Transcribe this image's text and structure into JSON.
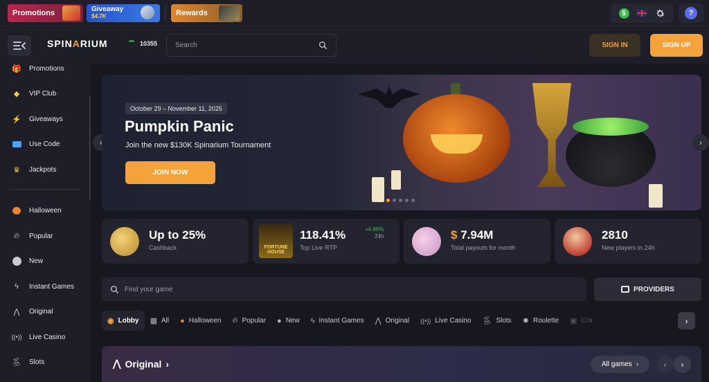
{
  "topbar": {
    "promos": [
      {
        "label": "Promotions"
      },
      {
        "label": "Giveaway",
        "amount": "$4.7K"
      },
      {
        "label": "Rewards"
      }
    ]
  },
  "header": {
    "logo": {
      "a": "SPIN",
      "b": "A",
      "c": "RIUM"
    },
    "online_count": "10355",
    "search_placeholder": "Search",
    "sign_in": "SIGN IN",
    "sign_up": "SIGN UP"
  },
  "sidebar": {
    "items": [
      {
        "label": "Promotions",
        "icon": "gift-icon"
      },
      {
        "label": "VIP Club",
        "icon": "diamond-icon"
      },
      {
        "label": "Giveaways",
        "icon": "lightning-icon"
      },
      {
        "label": "Use Code",
        "icon": "ticket-icon"
      },
      {
        "label": "Jackpots",
        "icon": "crown-icon"
      },
      {
        "label": "Halloween",
        "icon": "pumpkin-icon"
      },
      {
        "label": "Popular",
        "icon": "flame-icon"
      },
      {
        "label": "New",
        "icon": "new-badge-icon"
      },
      {
        "label": "Instant Games",
        "icon": "bolt-icon"
      },
      {
        "label": "Original",
        "icon": "spinarium-logo-icon"
      },
      {
        "label": "Live Casino",
        "icon": "broadcast-icon"
      },
      {
        "label": "Slots",
        "icon": "cherry-icon"
      }
    ]
  },
  "banner": {
    "date": "October 29 – November 11, 2025",
    "title": "Pumpkin Panic",
    "subtitle": "Join the new $130K Spinarium Tournament",
    "cta": "JOIN NOW",
    "slides": 5,
    "active_slide": 1
  },
  "stats": [
    {
      "value": "Up to 25%",
      "label": "Cashback"
    },
    {
      "value": "118.41%",
      "label": "Top Live RTP",
      "delta": "+4.86%",
      "period": "24h",
      "thumb": "FORTUNE HOUSE"
    },
    {
      "currency": "$",
      "value": "7.94M",
      "label": "Total payouts for month"
    },
    {
      "value": "2810",
      "label": "New players in 24h"
    }
  ],
  "games": {
    "search_placeholder": "Find your game",
    "providers": "PROVIDERS",
    "categories": [
      {
        "label": "Lobby",
        "icon": "lobby-icon"
      },
      {
        "label": "All",
        "icon": "grid-icon"
      },
      {
        "label": "Halloween",
        "icon": "pumpkin-icon"
      },
      {
        "label": "Popular",
        "icon": "flame-icon"
      },
      {
        "label": "New",
        "icon": "new-badge-icon"
      },
      {
        "label": "Instant Games",
        "icon": "bolt-icon"
      },
      {
        "label": "Original",
        "icon": "spinarium-logo-icon"
      },
      {
        "label": "Live Casino",
        "icon": "broadcast-icon"
      },
      {
        "label": "Slots",
        "icon": "cherry-icon"
      },
      {
        "label": "Roulette",
        "icon": "roulette-icon"
      },
      {
        "label": "Cra",
        "icon": "crash-icon"
      }
    ]
  },
  "section": {
    "title": "Original",
    "all_games": "All games"
  },
  "colors": {
    "accent": "#f3a33a",
    "bg": "#17181f",
    "panel": "#1d1e27",
    "card": "#23242f",
    "positive": "#3fb950"
  }
}
